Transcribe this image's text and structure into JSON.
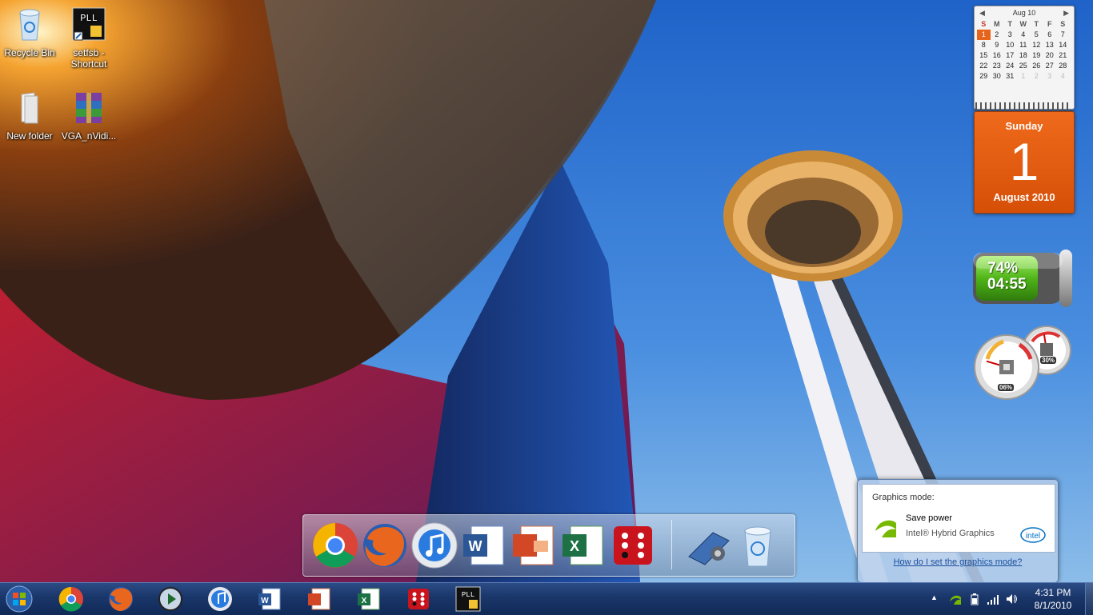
{
  "desktop_icons": [
    {
      "label": "Recycle Bin",
      "icon": "recycle-bin-icon"
    },
    {
      "label": "setfsb - Shortcut",
      "icon": "setfsb-shortcut-icon"
    },
    {
      "label": "New folder",
      "icon": "folder-icon"
    },
    {
      "label": "VGA_nVidi...",
      "icon": "winrar-archive-icon"
    }
  ],
  "calendar": {
    "month_label": "Aug 10",
    "weekdays": [
      "S",
      "M",
      "T",
      "W",
      "T",
      "F",
      "S"
    ],
    "weeks": [
      [
        "1",
        "2",
        "3",
        "4",
        "5",
        "6",
        "7"
      ],
      [
        "8",
        "9",
        "10",
        "11",
        "12",
        "13",
        "14"
      ],
      [
        "15",
        "16",
        "17",
        "18",
        "19",
        "20",
        "21"
      ],
      [
        "22",
        "23",
        "24",
        "25",
        "26",
        "27",
        "28"
      ],
      [
        "29",
        "30",
        "31",
        "1",
        "2",
        "3",
        "4"
      ]
    ],
    "day_name": "Sunday",
    "day_number": "1",
    "month_year": "August 2010"
  },
  "battery": {
    "percent_text": "74%",
    "time_text": "04:55",
    "level": 0.74
  },
  "meters": {
    "cpu_text": "06%",
    "memory_text": "30%",
    "cpu_level": 0.06,
    "memory_level": 0.3
  },
  "dock": {
    "items": [
      "chrome-icon",
      "firefox-icon",
      "itunes-icon",
      "word-icon",
      "powerpoint-icon",
      "excel-icon",
      "dice-app-icon"
    ],
    "utilities": [
      "dock-settings-icon",
      "recycle-bin-icon"
    ]
  },
  "popup": {
    "title": "Graphics mode:",
    "mode": "Save power",
    "subtitle": "Intel® Hybrid Graphics",
    "logo_text": "intel",
    "link": "How do I set the graphics mode?"
  },
  "taskbar": {
    "items": [
      "chrome-icon",
      "firefox-icon",
      "media-center-icon",
      "itunes-icon",
      "word-icon",
      "powerpoint-icon",
      "excel-icon",
      "dice-app-icon",
      "setfsb-icon"
    ],
    "clock_time": "4:31 PM",
    "clock_date": "8/1/2010"
  },
  "colors": {
    "taskbar": "#1a3669",
    "calendar_accent": "#e8641b",
    "battery_green": "#5cc41e",
    "link": "#1b4f9c"
  }
}
